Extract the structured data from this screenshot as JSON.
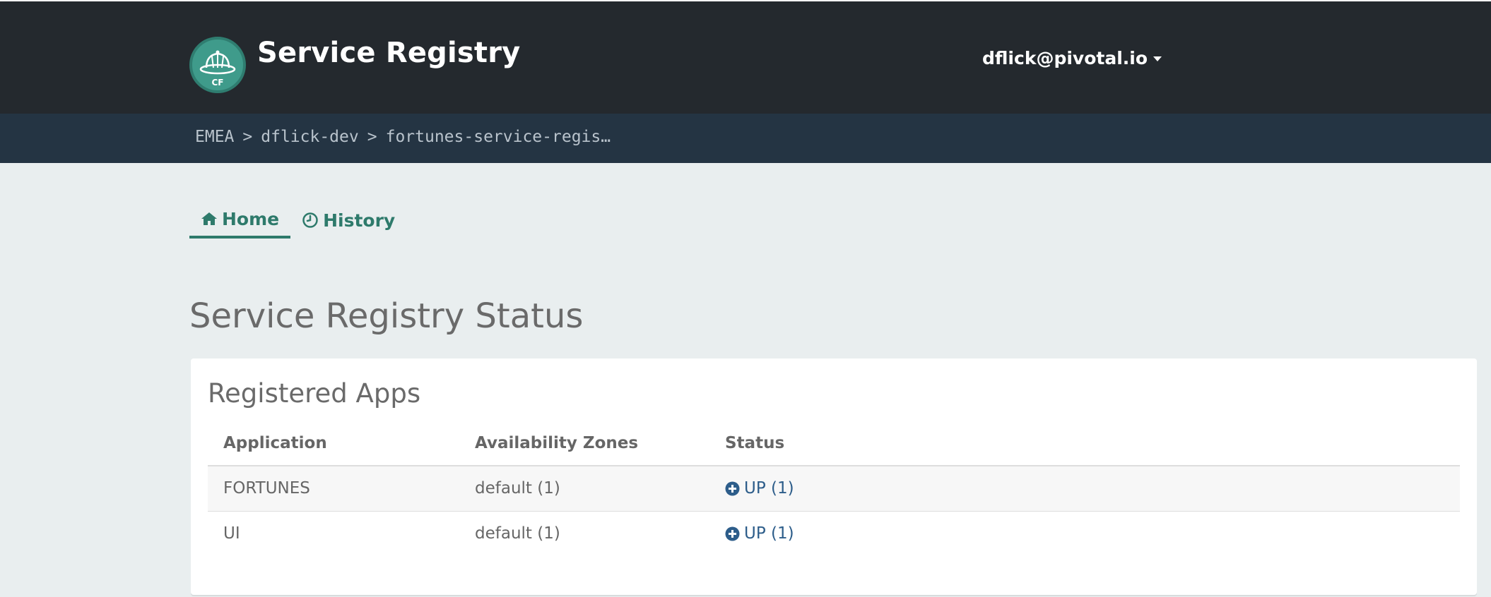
{
  "header": {
    "app_title": "Service Registry",
    "logo_text": "CF",
    "user_menu_label": "dflick@pivotal.io"
  },
  "breadcrumb": {
    "items": [
      "EMEA",
      ">",
      "dflick-dev",
      ">",
      "fortunes-service-regis…"
    ]
  },
  "tabs": [
    {
      "label": "Home",
      "icon": "home-icon",
      "active": true
    },
    {
      "label": "History",
      "icon": "clock-icon",
      "active": false
    }
  ],
  "main": {
    "page_title": "Service Registry Status",
    "panel_title": "Registered Apps",
    "columns": [
      "Application",
      "Availability Zones",
      "Status"
    ],
    "rows": [
      {
        "application": "FORTUNES",
        "zones": "default (1)",
        "status": "UP (1)"
      },
      {
        "application": "UI",
        "zones": "default (1)",
        "status": "UP (1)"
      }
    ]
  },
  "colors": {
    "topbar": "#24292e",
    "breadcrumb_bar": "#243443",
    "accent": "#2e7a6b",
    "status_up": "#2d5d8a",
    "background": "#e9eeef"
  }
}
